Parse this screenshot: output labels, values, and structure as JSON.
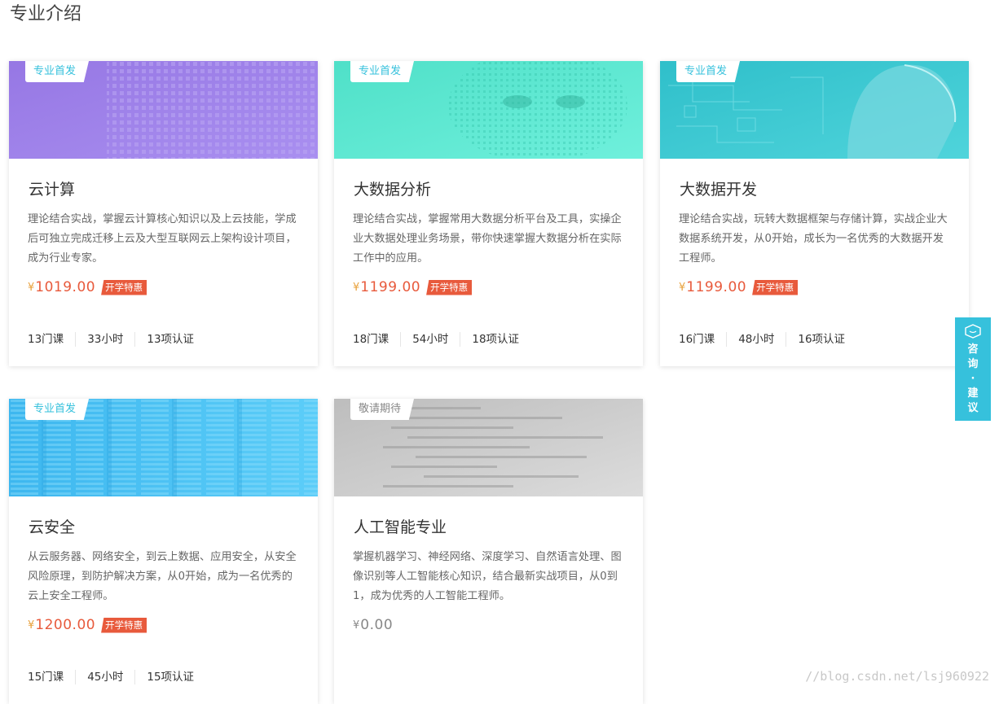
{
  "page_title": "专业介绍",
  "currency_symbol": "¥",
  "cards": [
    {
      "tag": "专业首发",
      "title": "云计算",
      "description": "理论结合实战，掌握云计算核心知识以及上云技能，学成后可独立完成迁移上云及大型互联网云上架构设计项目，成为行业专家。",
      "price": "1019.00",
      "promo": "开学特惠",
      "stats": [
        "13门课",
        "33小时",
        "13项认证"
      ],
      "theme": "purple"
    },
    {
      "tag": "专业首发",
      "title": "大数据分析",
      "description": "理论结合实战，掌握常用大数据分析平台及工具，实操企业大数据处理业务场景，带你快速掌握大数据分析在实际工作中的应用。",
      "price": "1199.00",
      "promo": "开学特惠",
      "stats": [
        "18门课",
        "54小时",
        "18项认证"
      ],
      "theme": "mint"
    },
    {
      "tag": "专业首发",
      "title": "大数据开发",
      "description": "理论结合实战，玩转大数据框架与存储计算，实战企业大数据系统开发，从0开始，成长为一名优秀的大数据开发工程师。",
      "price": "1199.00",
      "promo": "开学特惠",
      "stats": [
        "16门课",
        "48小时",
        "16项认证"
      ],
      "theme": "teal"
    },
    {
      "tag": "专业首发",
      "title": "云安全",
      "description": "从云服务器、网络安全，到云上数据、应用安全，从安全风险原理，到防护解决方案，从0开始，成为一名优秀的云上安全工程师。",
      "price": "1200.00",
      "promo": "开学特惠",
      "stats": [
        "15门课",
        "45小时",
        "15项认证"
      ],
      "theme": "blue"
    },
    {
      "tag": "敬请期待",
      "title": "人工智能专业",
      "description": "掌握机器学习、神经网络、深度学习、自然语言处理、图像识别等人工智能核心知识，结合最新实战项目，从0到1，成为优秀的人工智能工程师。",
      "price": "0.00",
      "promo": "",
      "stats": [],
      "theme": "gray"
    }
  ],
  "side_tab": {
    "label": "咨询·建议"
  },
  "watermark": "//blog.csdn.net/lsj960922",
  "colors": {
    "accent_cyan": "#36c1dc",
    "price_orange": "#e85a3c",
    "yen_gold": "#e8a13c",
    "gray_text": "#888888",
    "purple": "#9b83e6",
    "mint": "#5fe8d3",
    "teal": "#3ec8d1",
    "blue": "#4ec3f4",
    "gray": "#cfcfcf"
  }
}
